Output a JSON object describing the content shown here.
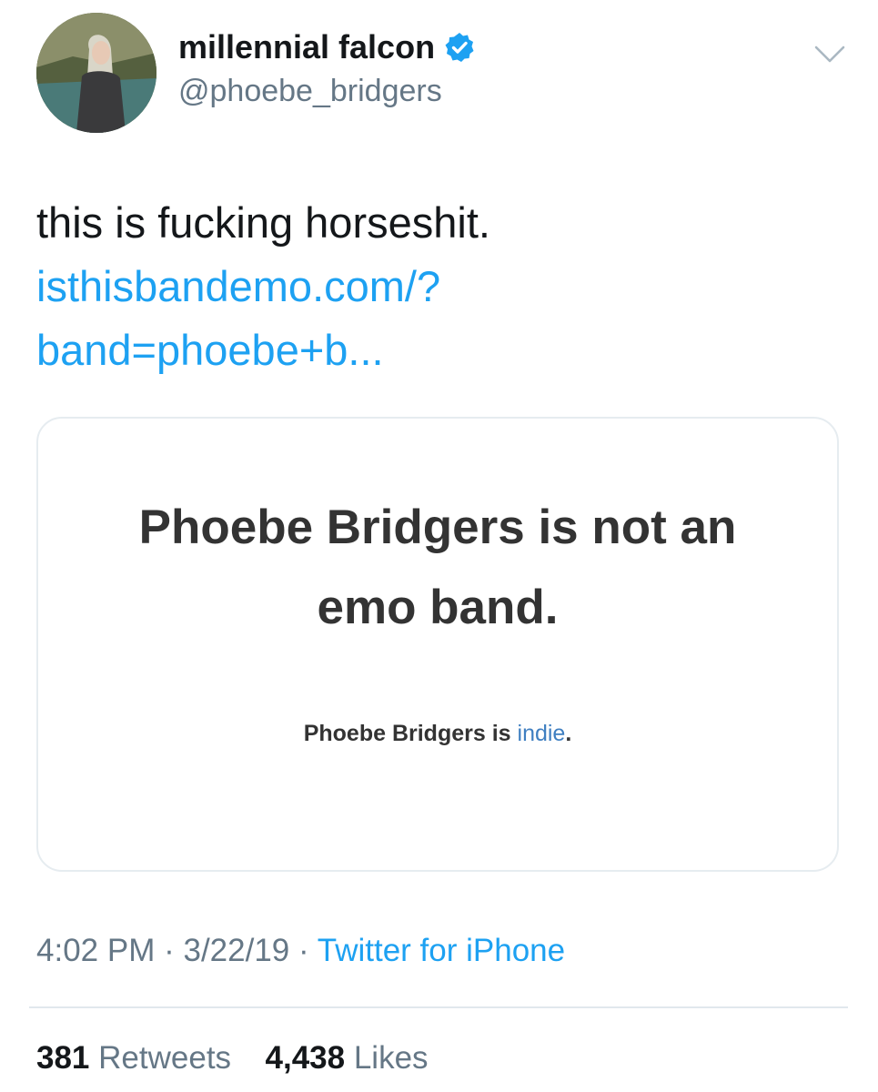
{
  "author": {
    "display_name": "millennial falcon",
    "handle": "@phoebe_bridgers",
    "verified": true
  },
  "tweet": {
    "text": "this is fucking horseshit.",
    "link_line1": "isthisbandemo.com/?",
    "link_line2": "band=phoebe+b..."
  },
  "card": {
    "headline_line1": "Phoebe Bridgers is not an",
    "headline_line2": "emo band.",
    "sub_prefix": "Phoebe Bridgers is",
    "sub_genre": "indie",
    "sub_suffix": "."
  },
  "meta": {
    "time": "4:02 PM",
    "sep1": "·",
    "date": "3/22/19",
    "sep2": "·",
    "source": "Twitter for iPhone"
  },
  "stats": {
    "retweets_count": "381",
    "retweets_label": "Retweets",
    "likes_count": "4,438",
    "likes_label": "Likes"
  },
  "colors": {
    "link": "#1da1f2",
    "secondary_text": "#657786",
    "primary_text": "#14171a",
    "verified_badge": "#1da1f2"
  },
  "icons": {
    "verified": "verified-badge-icon",
    "caret": "chevron-down-icon"
  }
}
